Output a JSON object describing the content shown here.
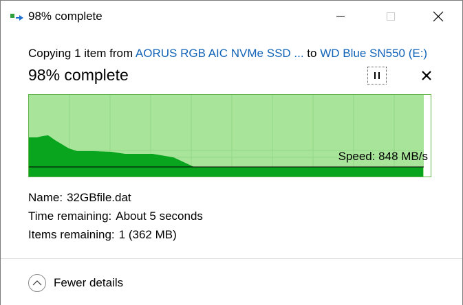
{
  "window": {
    "title": "98% complete"
  },
  "body": {
    "copy_prefix": "Copying 1 item from ",
    "source": "AORUS RGB AIC NVMe SSD ...",
    "copy_to": " to ",
    "destination": "WD Blue SN550 (E:)",
    "percent_heading": "98% complete",
    "progress_fraction": 0.98
  },
  "graph": {
    "speed_label": "Speed: 848 MB/s"
  },
  "details": {
    "name_key": "Name:",
    "name_value": "32GBfile.dat",
    "time_key": "Time remaining:",
    "time_value": "About 5 seconds",
    "items_key": "Items remaining:",
    "items_value": "1 (362 MB)"
  },
  "footer": {
    "toggle_label": "Fewer details"
  },
  "colors": {
    "graph_bg": "#a8e59a",
    "graph_fill": "#0aa51f",
    "link": "#1163b8"
  }
}
